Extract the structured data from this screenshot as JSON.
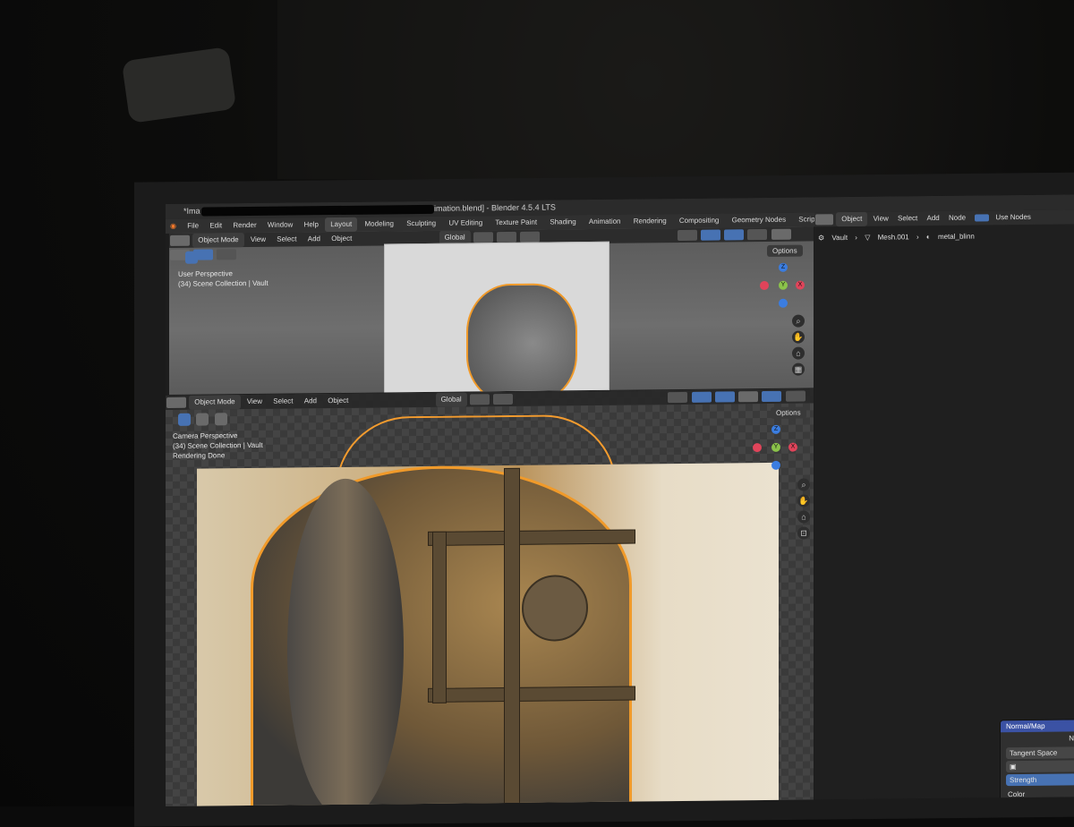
{
  "window": {
    "title_prefix": "*Ima",
    "title_suffix": "imation.blend] - Blender 4.5.4 LTS"
  },
  "menu": [
    "File",
    "Edit",
    "Render",
    "Window",
    "Help"
  ],
  "workspaces": [
    "Layout",
    "Modeling",
    "Sculpting",
    "UV Editing",
    "Texture Paint",
    "Shading",
    "Animation",
    "Rendering",
    "Compositing",
    "Geometry Nodes",
    "Scripting"
  ],
  "workspace_add": "+",
  "viewport_top": {
    "mode": "Object Mode",
    "menus": [
      "View",
      "Select",
      "Add",
      "Object"
    ],
    "transform": "Global",
    "overlay_line1": "User Perspective",
    "overlay_line2": "(34) Scene Collection | Vault",
    "options": "Options"
  },
  "viewport_bottom": {
    "mode": "Object Mode",
    "menus": [
      "View",
      "Select",
      "Add",
      "Object"
    ],
    "transform": "Global",
    "overlay_line1": "Camera Perspective",
    "overlay_line2": "(34) Scene Collection | Vault",
    "overlay_line3": "Rendering Done",
    "options": "Options"
  },
  "gizmo": {
    "x": "X",
    "y": "Y",
    "z": "Z"
  },
  "node_editor": {
    "type": "Object",
    "menus": [
      "View",
      "Select",
      "Add",
      "Node"
    ],
    "use_nodes": "Use Nodes",
    "breadcrumb": [
      "Vault",
      "Mesh.001",
      "metal_blinn"
    ]
  },
  "normal_map_node": {
    "title": "Normal/Map",
    "space": "Tangent Space",
    "strength_label": "Strength",
    "color_label": "Color",
    "partial_right": "N"
  },
  "colors": {
    "accent": "#4772b3",
    "selection": "#f09a2a",
    "x_axis": "#e0445a",
    "y_axis": "#8bc34a",
    "z_axis": "#3b7de0"
  }
}
